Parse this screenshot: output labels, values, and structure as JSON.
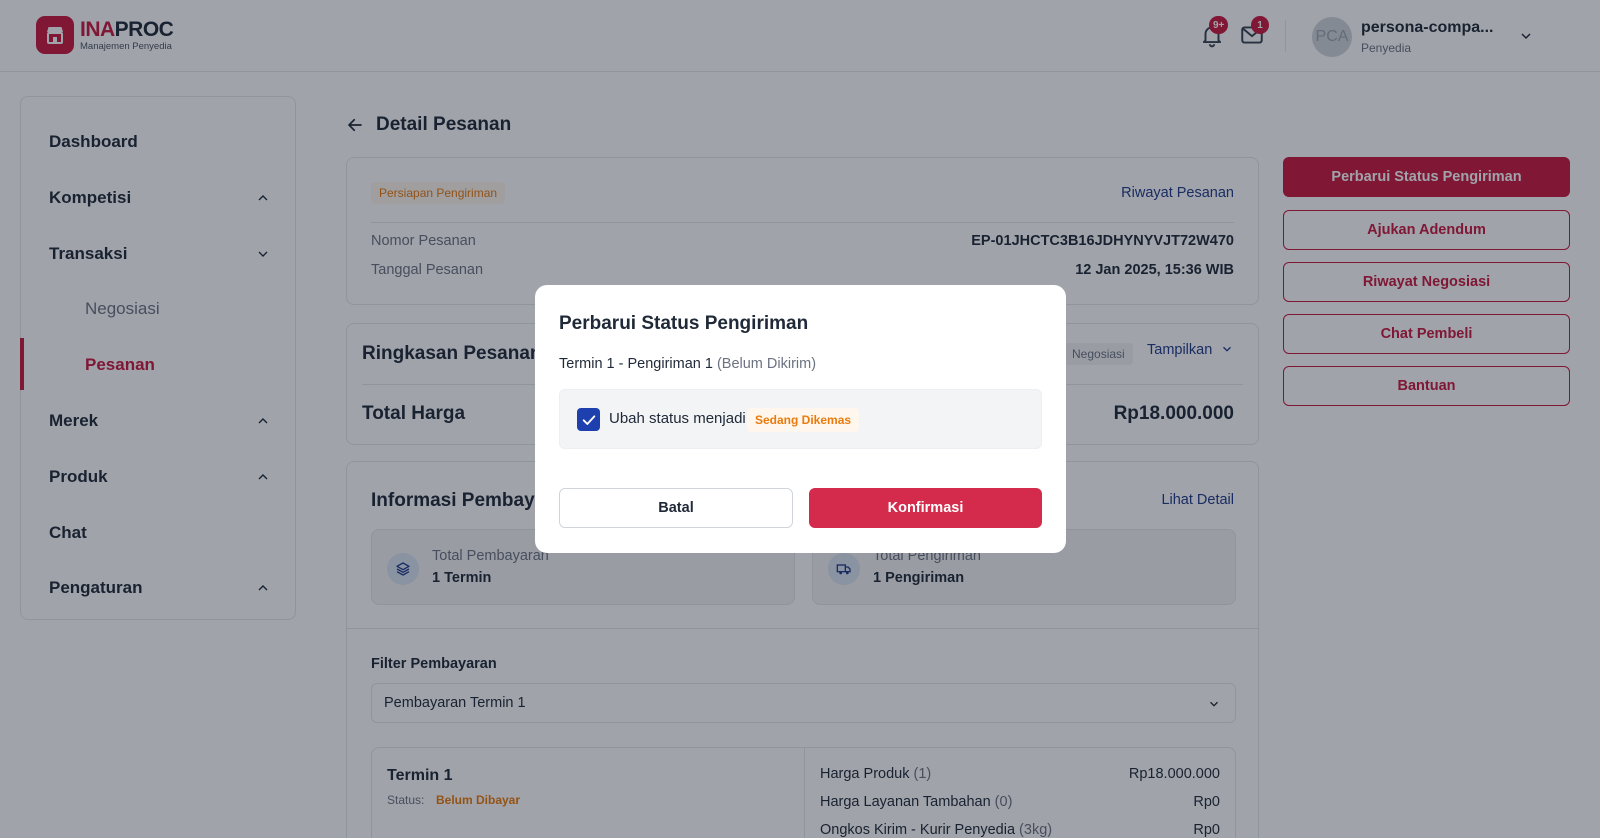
{
  "header": {
    "logo_brand_a": "INA",
    "logo_brand_b": "PROC",
    "logo_sub": "Manajemen Penyedia",
    "notif_badge": "9+",
    "mail_badge": "1",
    "avatar_initials": "PCA",
    "user_name": "persona-compa...",
    "user_role": "Penyedia"
  },
  "sidebar": {
    "items": [
      {
        "label": "Dashboard"
      },
      {
        "label": "Kompetisi"
      },
      {
        "label": "Transaksi"
      },
      {
        "label": "Negosiasi"
      },
      {
        "label": "Pesanan"
      },
      {
        "label": "Merek"
      },
      {
        "label": "Produk"
      },
      {
        "label": "Chat"
      },
      {
        "label": "Pengaturan"
      }
    ]
  },
  "main": {
    "page_title": "Detail Pesanan",
    "order": {
      "status_tag": "Persiapan Pengiriman",
      "history_link": "Riwayat Pesanan",
      "number_label": "Nomor Pesanan",
      "number_value": "EP-01JHCTC3B16JDHYNYVJT72W470",
      "date_label": "Tanggal Pesanan",
      "date_value": "12 Jan 2025, 15:36 WIB"
    },
    "summary": {
      "title": "Ringkasan Pesanan",
      "nego_tag": "Negosiasi",
      "show_link": "Tampilkan",
      "total_label": "Total Harga",
      "total_value": "Rp18.000.000"
    },
    "payment": {
      "title": "Informasi Pembayaran",
      "detail_link": "Lihat Detail",
      "total_payment_label": "Total Pembayaran",
      "total_payment_value": "1 Termin",
      "total_shipping_label": "Total Pengiriman",
      "total_shipping_value": "1 Pengiriman",
      "filter_label": "Filter Pembayaran",
      "filter_value": "Pembayaran Termin 1",
      "termin_title": "Termin 1",
      "termin_status_label": "Status:",
      "termin_status_value": "Belum Dibayar",
      "lines": [
        {
          "label": "Harga Produk",
          "qty": "(1)",
          "value": "Rp18.000.000"
        },
        {
          "label": "Harga Layanan Tambahan",
          "qty": "(0)",
          "value": "Rp0"
        },
        {
          "label": "Ongkos Kirim - Kurir Penyedia",
          "qty": "(3kg)",
          "value": "Rp0"
        }
      ]
    }
  },
  "actions": {
    "primary": "Perbarui Status Pengiriman",
    "adendum": "Ajukan Adendum",
    "nego_history": "Riwayat Negosiasi",
    "chat_buyer": "Chat Pembeli",
    "help": "Bantuan"
  },
  "modal": {
    "title": "Perbarui Status Pengiriman",
    "subtitle": "Termin 1 - Pengiriman 1",
    "subtitle_status": "(Belum Dikirim)",
    "checkbox_label": "Ubah status menjadi",
    "checkbox_checked": true,
    "new_status": "Sedang Dikemas",
    "cancel_label": "Batal",
    "confirm_label": "Konfirmasi"
  },
  "colors": {
    "brand": "#c8163f",
    "link": "#1e3a8a",
    "status_orange": "#ea7a0c",
    "checkbox": "#1e40af"
  }
}
